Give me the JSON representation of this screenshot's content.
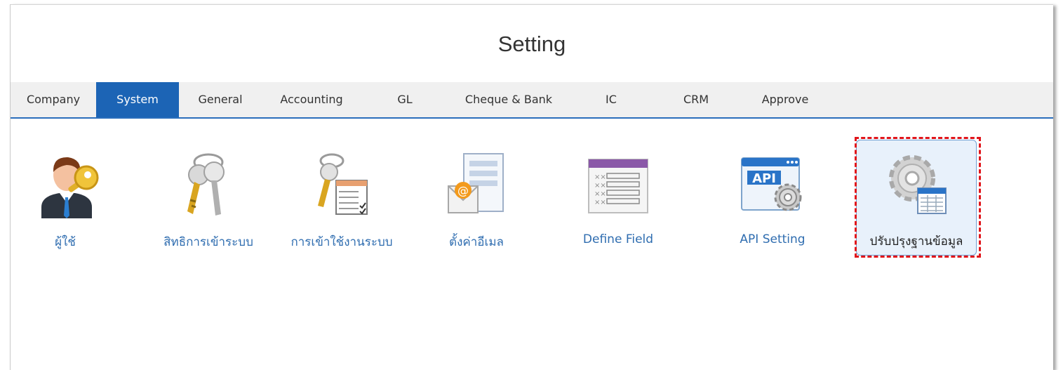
{
  "window": {
    "title": "Setting"
  },
  "tabs": [
    {
      "label": "Company",
      "active": false
    },
    {
      "label": "System",
      "active": true
    },
    {
      "label": "General",
      "active": false
    },
    {
      "label": "Accounting",
      "active": false
    },
    {
      "label": "GL",
      "active": false
    },
    {
      "label": "Cheque & Bank",
      "active": false
    },
    {
      "label": "IC",
      "active": false
    },
    {
      "label": "CRM",
      "active": false
    },
    {
      "label": "Approve",
      "active": false
    }
  ],
  "apps": [
    {
      "label": "ผู้ใช้",
      "icon": "user-key-icon"
    },
    {
      "label": "สิทธิการเข้าระบบ",
      "icon": "keys-icon"
    },
    {
      "label": "การเข้าใช้งานระบบ",
      "icon": "keys-checklist-icon"
    },
    {
      "label": "ตั้งค่าอีเมล",
      "icon": "email-settings-icon"
    },
    {
      "label": "Define Field",
      "icon": "define-field-icon"
    },
    {
      "label": "API Setting",
      "icon": "api-settings-icon"
    },
    {
      "label": "ปรับปรุงฐานข้อมูล",
      "icon": "gear-database-icon",
      "selected": true
    }
  ],
  "colors": {
    "tab_active_bg": "#1c64b5",
    "tab_underline": "#2a6ebb",
    "link_text": "#2f6db0",
    "highlight_border": "#e0151b"
  }
}
